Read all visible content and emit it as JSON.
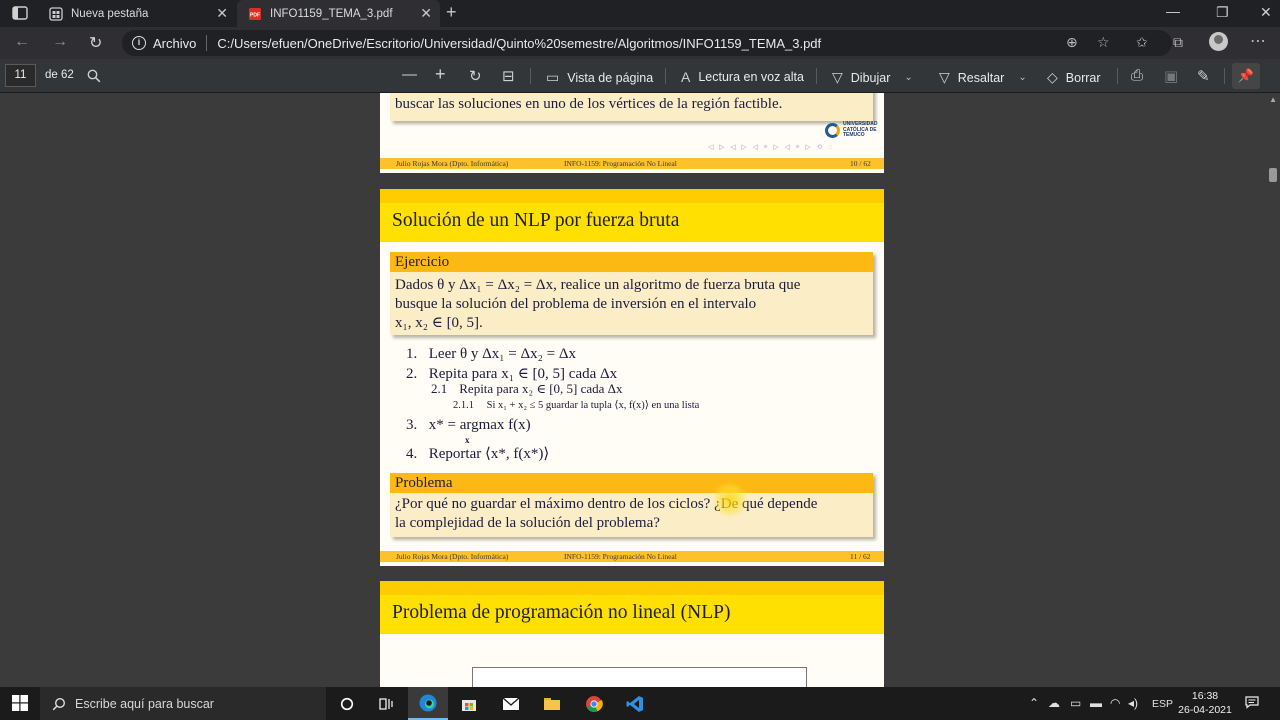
{
  "browser": {
    "tabs": [
      {
        "label": "Nueva pestaña",
        "active": false
      },
      {
        "label": "INFO1159_TEMA_3.pdf",
        "active": true
      }
    ],
    "site_label": "Archivo",
    "url": "C:/Users/efuen/OneDrive/Escritorio/Universidad/Quinto%20semestre/Algoritmos/INFO1159_TEMA_3.pdf"
  },
  "pdf_toolbar": {
    "page_value": "11",
    "page_total": "de 62",
    "page_view_label": "Vista de página",
    "read_aloud_label": "Lectura en voz alta",
    "draw_label": "Dibujar",
    "highlight_label": "Resaltar",
    "erase_label": "Borrar"
  },
  "pages": {
    "prev": {
      "text_line": "buscar las soluciones en uno de los vértices de la región factible.",
      "logo_lines": [
        "UNIVERSIDAD",
        "CATÓLICA DE",
        "TEMUCO"
      ],
      "footer_author": "Julio Rojas Mora  (Dpto. Informática)",
      "footer_course": "INFO-1159: Programación No Lineal",
      "footer_page": "10 / 62"
    },
    "current": {
      "title": "Solución de un NLP por fuerza bruta",
      "exercise_head": "Ejercicio",
      "exercise_line1": "Dados θ y Δx₁ = Δx₂ = Δx, realice un algoritmo de fuerza bruta que",
      "exercise_line2": "busque la solución del problema de inversión en el intervalo",
      "exercise_line3": "x₁, x₂ ∈ [0, 5].",
      "steps": [
        {
          "num": "1.",
          "text": "Leer θ y Δx₁ = Δx₂ = Δx"
        },
        {
          "num": "2.",
          "text": "Repita para x₁ ∈ [0, 5] cada Δx"
        },
        {
          "num": "2.1",
          "text": "Repita para x₂ ∈ [0, 5] cada Δx"
        },
        {
          "num": "2.1.1",
          "text": "Si x₁ + x₂ ≤ 5 guardar la tupla ⟨x, f(x)⟩ en una lista"
        },
        {
          "num": "3.",
          "text": "x* = argmax f(x)"
        },
        {
          "num": "4.",
          "text": "Reportar ⟨x*, f(x*)⟩"
        }
      ],
      "argmax_sub": "x",
      "problem_head": "Problema",
      "problem_line1": "¿Por qué no guardar el máximo dentro de los ciclos? ¿De qué depende",
      "problem_line2": "la complejidad de la solución del problema?",
      "footer_author": "Julio Rojas Mora  (Dpto. Informática)",
      "footer_course": "INFO-1159: Programación No Lineal",
      "footer_page": "11 / 62"
    },
    "next": {
      "title": "Problema de programación no lineal (NLP)"
    }
  },
  "taskbar": {
    "search_placeholder": "Escribe aquí para buscar",
    "language": "ESP",
    "time": "16:38",
    "date": "26-04-2021"
  }
}
